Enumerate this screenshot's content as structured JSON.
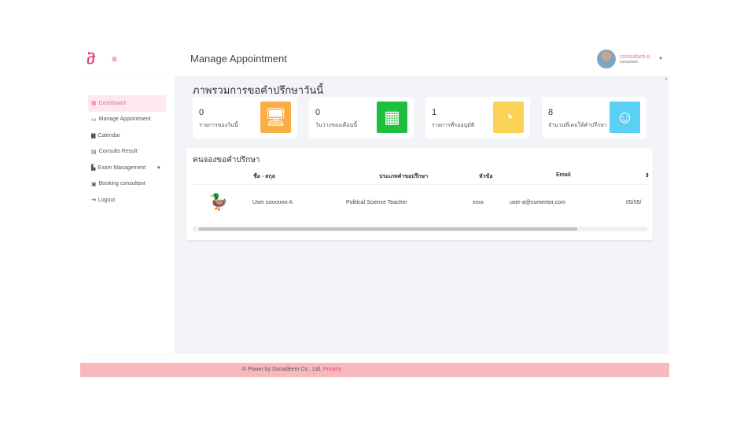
{
  "header": {
    "logo": "ⴋ",
    "menu_icon": "≡",
    "title": "Manage Appointment",
    "user_name": "consultant-a",
    "user_role": "consultant"
  },
  "sidebar": {
    "items": [
      {
        "icon": "▦",
        "label": "Dashboard"
      },
      {
        "icon": "▭",
        "label": "Manage Appointment"
      },
      {
        "icon": "▆",
        "label": "Calendar"
      },
      {
        "icon": "▤",
        "label": "Consults Result"
      },
      {
        "icon": "▙",
        "label": "Exam Management",
        "caret": "▾"
      },
      {
        "icon": "▣",
        "label": "Booking consultant"
      },
      {
        "icon": "⇥",
        "label": "Logout"
      }
    ]
  },
  "overview": {
    "title": "ภาพรวมการขอคำปรึกษาวันนี้",
    "cards": [
      {
        "value": "0",
        "label": "รายการของวันนี้",
        "color": "#f8ae45",
        "icon": "🖥"
      },
      {
        "value": "0",
        "label": "วันว่างของเดือนนี้",
        "color": "#1ebe3e",
        "icon": "▦"
      },
      {
        "value": "1",
        "label": "รายการที่รออนุมัติ",
        "color": "#fcd357",
        "icon": "◔"
      },
      {
        "value": "8",
        "label": "จำนวนที่เคยให้คำปรึกษา",
        "color": "#5bd0f5",
        "icon": "☺"
      }
    ]
  },
  "bookings": {
    "title": "คนจองขอคำปรึกษา",
    "headers": [
      "ชื่อ - สกุล",
      "ประเภทคำขอปรึกษา",
      "หัวข้อ",
      "Email",
      "⇕"
    ],
    "rows": [
      {
        "avatar": "🦆",
        "name": "User xxxxxxxx A",
        "type": "Political Science Teacher",
        "topic": "xxxx",
        "email": "user-a@cumentor.com",
        "date": "05/05/"
      }
    ]
  },
  "footer": {
    "text": "© Power by Donadeem Co., Ltd.",
    "link": "Privacy"
  }
}
